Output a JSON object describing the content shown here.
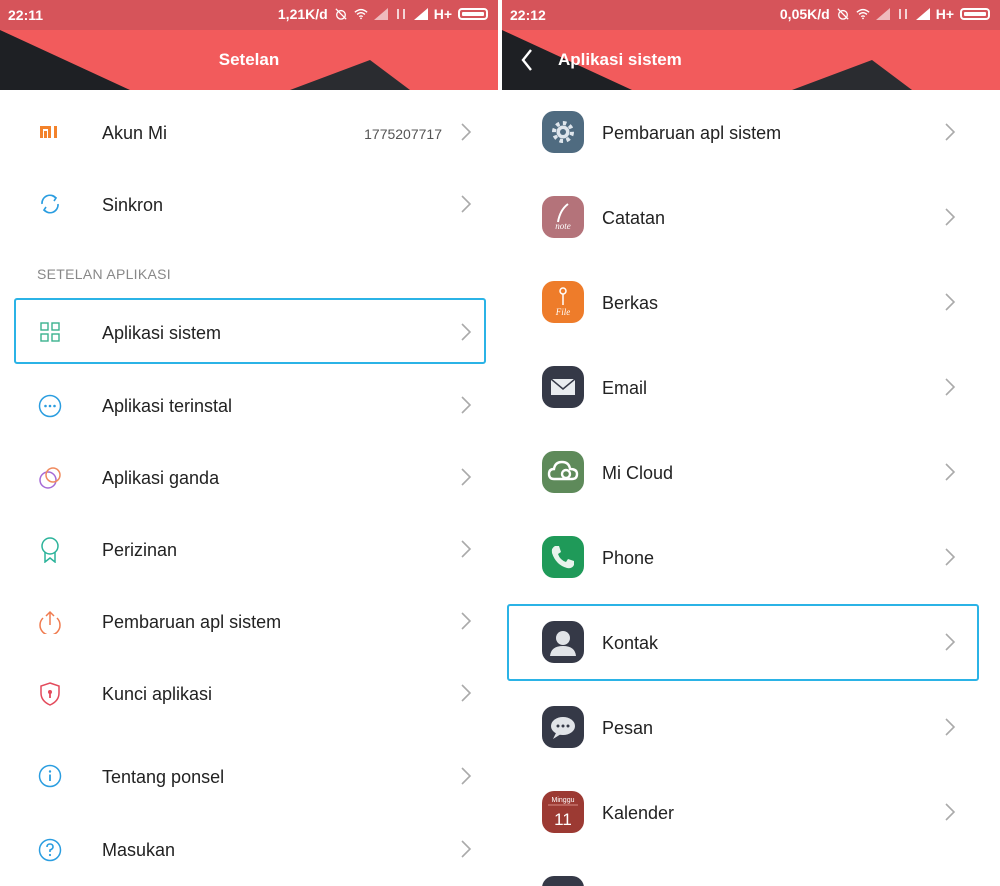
{
  "left": {
    "status": {
      "time": "22:11",
      "speed": "1,21K/d",
      "network": "H+"
    },
    "title": "Setelan",
    "account": {
      "label": "Akun Mi",
      "value": "1775207717"
    },
    "sync_label": "Sinkron",
    "section_title": "SETELAN APLIKASI",
    "items": [
      {
        "label": "Aplikasi sistem"
      },
      {
        "label": "Aplikasi terinstal"
      },
      {
        "label": "Aplikasi ganda"
      },
      {
        "label": "Perizinan"
      },
      {
        "label": "Pembaruan apl sistem"
      },
      {
        "label": "Kunci aplikasi"
      },
      {
        "label": "Tentang ponsel"
      },
      {
        "label": "Masukan"
      }
    ]
  },
  "right": {
    "status": {
      "time": "22:12",
      "speed": "0,05K/d",
      "network": "H+"
    },
    "title": "Aplikasi sistem",
    "items": [
      {
        "label": "Pembaruan apl sistem",
        "icon": "gear-icon"
      },
      {
        "label": "Catatan",
        "icon": "notes-icon"
      },
      {
        "label": "Berkas",
        "icon": "files-icon"
      },
      {
        "label": "Email",
        "icon": "email-icon"
      },
      {
        "label": "Mi Cloud",
        "icon": "cloud-icon"
      },
      {
        "label": "Phone",
        "icon": "phone-icon"
      },
      {
        "label": "Kontak",
        "icon": "contact-icon"
      },
      {
        "label": "Pesan",
        "icon": "message-icon"
      },
      {
        "label": "Kalender",
        "icon": "calendar-icon"
      }
    ],
    "icon_texts": {
      "notes": "note",
      "files": "File",
      "calendar_day": "Minggu",
      "calendar_date": "11"
    }
  },
  "colors": {
    "header": "#f25b5c",
    "statusbar": "#d6545a",
    "highlight": "#2bb3e6"
  }
}
